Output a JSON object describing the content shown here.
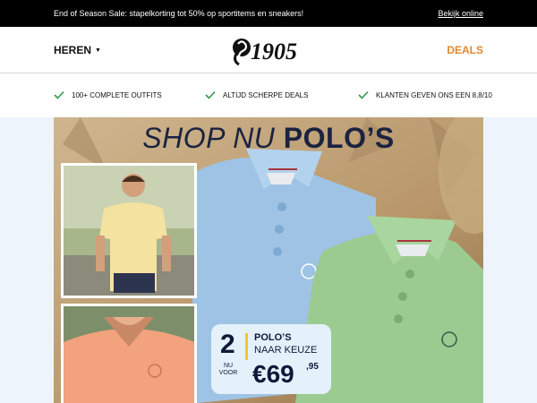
{
  "promo": {
    "text": "End of Season Sale: stapelkorting tot 50% op sportitems en sneakers!",
    "link": "Bekijk online"
  },
  "header": {
    "menu_label": "HEREN",
    "logo_text": "1905",
    "deals_label": "DEALS"
  },
  "usps": [
    {
      "label": "100+ COMPLETE OUTFITS",
      "icon": "check-icon"
    },
    {
      "label": "ALTIJD SCHERPE DEALS",
      "icon": "check-icon"
    },
    {
      "label": "KLANTEN GEVEN ONS EEN 8,8/10",
      "icon": "check-icon"
    }
  ],
  "hero": {
    "headline_light": "SHOP NU",
    "headline_bold": "POLO’S",
    "badge": {
      "quantity": "2",
      "quantity_label": "NU VOOR",
      "product": "POLO’S",
      "choice": "NAAR KEUZE",
      "price": "€69",
      "cents": ",95"
    }
  },
  "colors": {
    "accent": "#e08a2c",
    "check": "#2e9a4a",
    "navy": "#1a2340",
    "badge_bg": "#e4f1fb"
  }
}
